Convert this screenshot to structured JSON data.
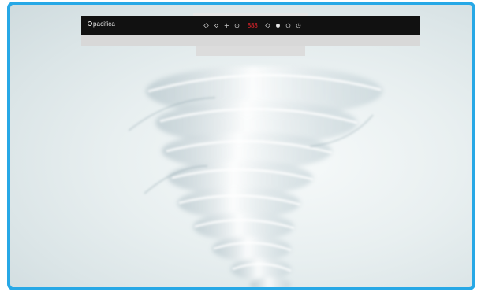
{
  "brand": {
    "name": "pacifica"
  },
  "controls": [
    {
      "id": "fan-down",
      "icon": "diamond-outline-icon"
    },
    {
      "id": "fan-up",
      "icon": "diamond-small-icon"
    },
    {
      "id": "plus",
      "icon": "plus-icon"
    },
    {
      "id": "light",
      "icon": "circle-dot-icon"
    },
    {
      "id": "mode",
      "icon": "diamond-outline-icon"
    },
    {
      "id": "power",
      "icon": "filled-circle-icon"
    },
    {
      "id": "timer",
      "icon": "ring-icon"
    },
    {
      "id": "clock",
      "icon": "clock-icon"
    }
  ],
  "display": {
    "value": "888"
  },
  "colors": {
    "frame": "#27a8e6",
    "panel": "#111111",
    "display": "#e0242b",
    "background": "#dfe8ea"
  }
}
